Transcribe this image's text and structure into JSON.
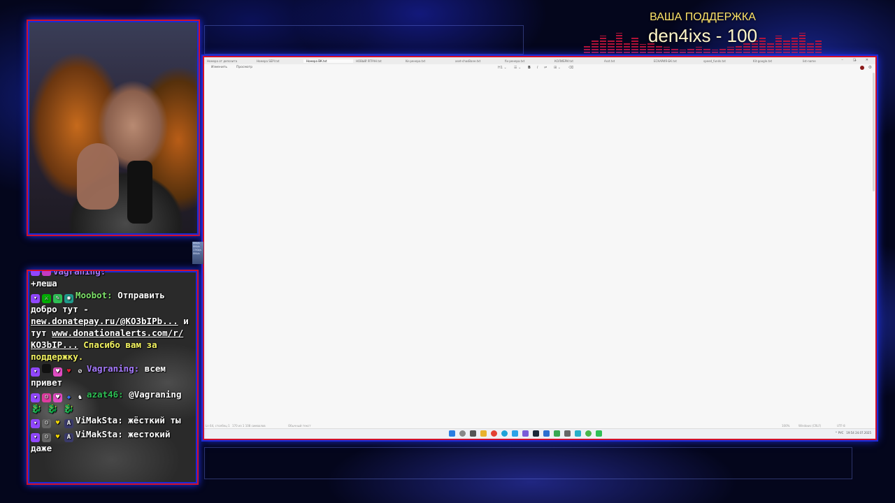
{
  "donation": {
    "title": "ВАША ПОДДЕРЖКА",
    "line": "den4ixs - 100"
  },
  "editor": {
    "tabs": [
      "Номера от депозита",
      "Номера SEPI.txt",
      "Номера ВК.txt",
      "НОВЫЙ ЯГРАН.txt",
      "Ke-рeнeрa.txt",
      "aset-chasBane.txt",
      "fix-рeнeрa.txt",
      "КОЛИБРИ.txt",
      "Asst.txt",
      "ЕСКАРИЯ-БК.txt",
      "speed_funds.txt",
      "Kit-google.txt",
      "list-name"
    ],
    "active_tab_index": 2,
    "menu": [
      "Изменить",
      "Просмотр"
    ],
    "format_tools": [
      "H1 ⌄",
      "☰ ⌄",
      "B",
      "I",
      "⇌",
      "⊞ ⌄",
      "⌫"
    ],
    "status_left": [
      "Ln 64, столбец 1",
      "170 из 1 108 символов",
      "Обычный текст"
    ],
    "status_right": [
      "100%",
      "Windows (CRLF)",
      "UTF-8"
    ],
    "tray_text": "^ РУС",
    "clock": [
      "19:54",
      "24.07.2025"
    ]
  },
  "mini_widget": [
    "0Kb/s",
    "0Kb/s",
    "17Kb/s",
    "0Kb/s"
  ],
  "chat": {
    "messages": [
      {
        "user": "Vagraning:",
        "text": "",
        "color": "#a77bff",
        "cut": true
      },
      {
        "user": "",
        "text": "+леша",
        "color": "#ffffff"
      },
      {
        "user": "Moobot:",
        "text": "Отправить добро тут -",
        "link1": "new.donatepay.ru/@КО3bIPb...",
        "mid": "и тут",
        "link2": "www.donationalerts.com/r/КО3bIP...",
        "tail": "Спасибо вам за поддержку.",
        "color": "#7ee36a"
      },
      {
        "user": "Vagraning:",
        "text": "всем привет",
        "color": "#a77bff"
      },
      {
        "user": "azat46:",
        "text": "@Vagraning 🐉 🐉 🐉",
        "color": "#2fbf55"
      },
      {
        "user": "ViMakSta:",
        "text": "жёсткий ты",
        "color": "#ffffff"
      },
      {
        "user": "ViMakSta:",
        "text": "жестокий даже",
        "color": "#ffffff"
      }
    ]
  },
  "colors": {
    "frame_red": "#d0102a",
    "frame_blue": "#1b2bd8",
    "donation_title": "#ffe46a"
  }
}
